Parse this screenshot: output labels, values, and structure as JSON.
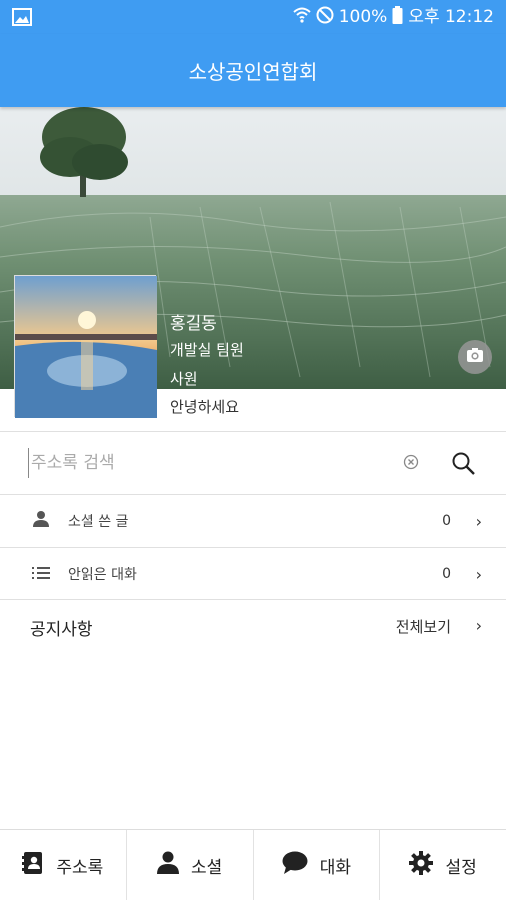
{
  "statusbar": {
    "battery": "100%",
    "time": "오후 12:12",
    "icons": [
      "image-icon",
      "wifi-icon",
      "do-not-disturb-icon",
      "battery-icon"
    ]
  },
  "appbar": {
    "title": "소상공인연합회"
  },
  "profile": {
    "name": "홍길동",
    "department": "개발실 팀원",
    "rank": "사원",
    "greeting": "안녕하세요"
  },
  "search": {
    "placeholder": "주소록 검색",
    "value": ""
  },
  "menu": {
    "my_posts": {
      "label": "소셜 쓴 글",
      "count": "0"
    },
    "unread": {
      "label": "안읽은 대화",
      "count": "0"
    }
  },
  "notice": {
    "title": "공지사항",
    "view_all": "전체보기"
  },
  "tabs": [
    {
      "label": "주소록",
      "icon": "contacts-icon"
    },
    {
      "label": "소셜",
      "icon": "person-icon"
    },
    {
      "label": "대화",
      "icon": "chat-icon"
    },
    {
      "label": "설정",
      "icon": "gear-icon"
    }
  ],
  "colors": {
    "primary": "#3f9cf2",
    "text": "#222222",
    "divider": "#e0e0e0"
  }
}
